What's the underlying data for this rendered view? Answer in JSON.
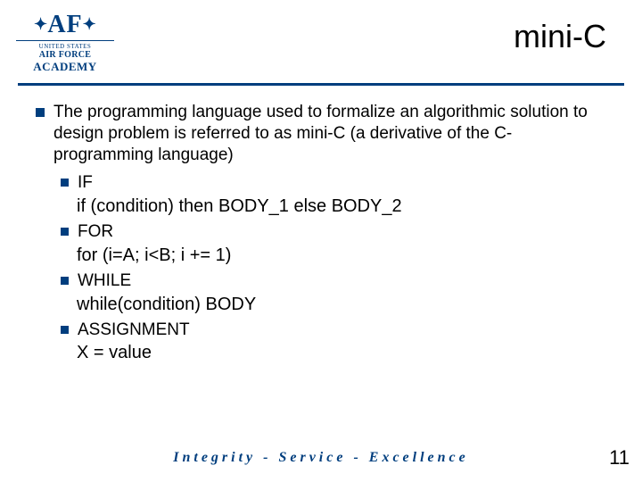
{
  "logo": {
    "monogram": "AF",
    "line1": "UNITED STATES",
    "line2": "AIR FORCE",
    "line3": "ACADEMY"
  },
  "title": "mini-C",
  "main_bullet": "The programming language used to formalize an algorithmic solution to design problem is referred to as mini-C (a derivative of the C-programming language)",
  "items": [
    {
      "head": "IF",
      "body": "if (condition) then BODY_1 else BODY_2"
    },
    {
      "head": "FOR",
      "body": "for (i=A; i<B; i += 1)"
    },
    {
      "head": "WHILE",
      "body": "while(condition) BODY"
    },
    {
      "head": "ASSIGNMENT",
      "body": "X = value"
    }
  ],
  "motto": "Integrity - Service - Excellence",
  "page_number": "11"
}
